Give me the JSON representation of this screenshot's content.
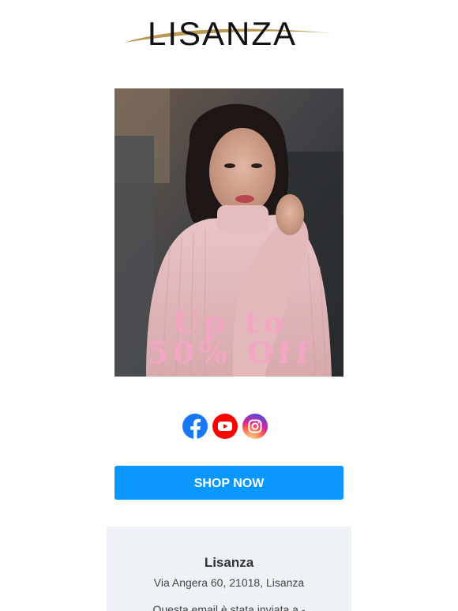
{
  "brand": {
    "logo_text": "LISANZA",
    "colors": {
      "swoosh": "#b89a52",
      "button": "#0a98ff",
      "promo_text": "#f3a6c4",
      "footer_bg": "#eef1f6"
    }
  },
  "hero": {
    "promo_line1": "Up to",
    "promo_line2": "50% Off",
    "image": "woman in pink ribbed turtleneck sweater"
  },
  "social": [
    {
      "name": "facebook",
      "icon": "facebook-icon"
    },
    {
      "name": "youtube",
      "icon": "youtube-icon"
    },
    {
      "name": "instagram",
      "icon": "instagram-icon"
    }
  ],
  "cta": {
    "label": "SHOP NOW"
  },
  "footer": {
    "company": "Lisanza",
    "address": "Via Angera 60, 21018, Lisanza",
    "note": "Questa email è stata inviata a -"
  }
}
